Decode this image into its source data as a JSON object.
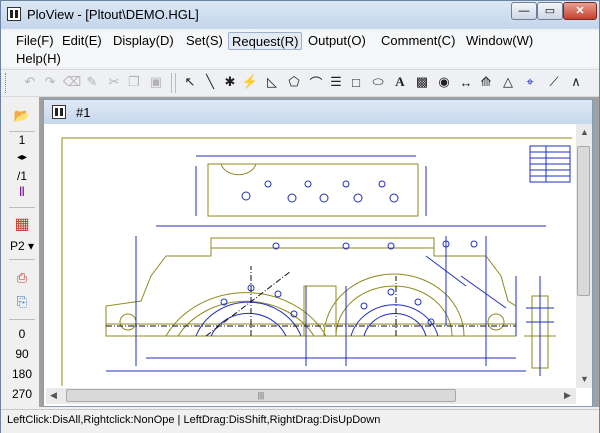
{
  "window": {
    "title": "PloView - [Pltout\\DEMO.HGL]",
    "minimize": "—",
    "maximize": "▭",
    "close": "✕"
  },
  "menu": {
    "file": "File(F)",
    "edit": "Edit(E)",
    "display": "Display(D)",
    "set": "Set(S)",
    "request": "Request(R)",
    "output": "Output(O)",
    "comment": "Comment(C)",
    "window": "Window(W)",
    "help": "Help(H)"
  },
  "left_toolbar": {
    "page_number": "1",
    "page_total": "/1",
    "pen_select": "P2",
    "rotations": [
      "0",
      "90",
      "180",
      "270"
    ]
  },
  "child_window": {
    "title": "#1"
  },
  "status": {
    "text": "LeftClick:DisAll,Rightclick:NonOpe  |  LeftDrag:DisShift,RightDrag:DisUpDown"
  },
  "colors": {
    "drawing_blue": "#1f2fbf",
    "drawing_olive": "#8f8a20",
    "drawing_black": "#111111"
  }
}
